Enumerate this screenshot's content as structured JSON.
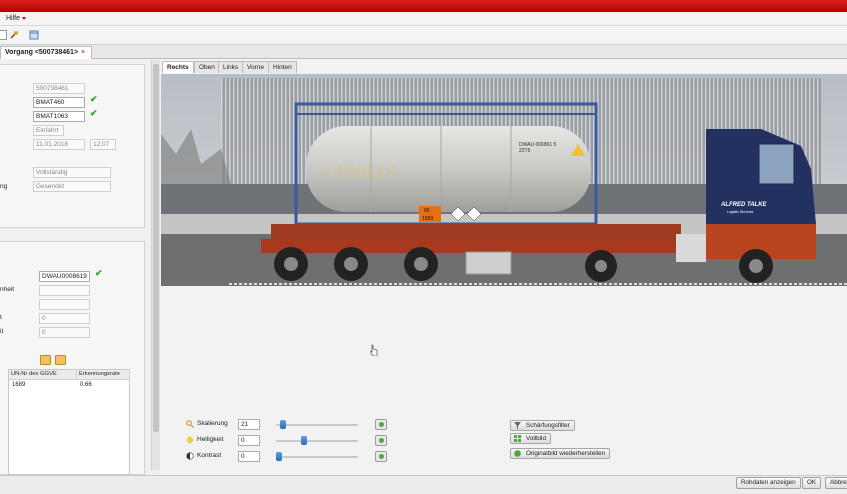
{
  "menu": {
    "help_label": "Hilfe"
  },
  "doc_tab": {
    "label": "Vorgang <500738461>",
    "close": "×"
  },
  "details": {
    "vorgang_nr": "500738461",
    "field2": "BMAT460",
    "field3": "BMAT1063",
    "richtung": "Einfahrt",
    "datum": "11.01.2018",
    "zeit": "12:07",
    "status1": "Vollständig",
    "status2_label": "ng",
    "status2": "Gesendet"
  },
  "detection": {
    "code": "DWAU0008619",
    "label_einheit": "nheit",
    "label_t": "t",
    "label_it": "it",
    "value1": "0",
    "value2": "0"
  },
  "table": {
    "headers": [
      "UN-Nr des GGVE",
      "Erkennungsrate"
    ],
    "rows": [
      {
        "un": "1689",
        "rate": "0.66"
      }
    ]
  },
  "view_tabs": [
    "Rechts",
    "Oben",
    "Links",
    "Vorne",
    "Hinten"
  ],
  "truck": {
    "container_code": "DWAU 006861 5",
    "container_iso": "22T6",
    "hazard_top": "66",
    "hazard_bottom": "1689",
    "brand": "ALFRED TALKE",
    "brand_sub": "Logistic Services",
    "tank_brand": "CYPRESS"
  },
  "adjust": {
    "scale_label": "Skalierung",
    "scale_value": "21",
    "scale_level": 0.05,
    "bright_label": "Helligkeit",
    "bright_value": "0",
    "bright_level": 0.33,
    "contrast_label": "Kontrast",
    "contrast_value": "0",
    "contrast_level": 0.0
  },
  "buttons": {
    "sharpen": "Schärfungsfilter",
    "fullscreen": "Vollbild",
    "restore": "Originalbild wiederherstellen"
  },
  "footer": {
    "raw": "Rohdaten anzeigen",
    "ok": "OK",
    "cancel": "Abbrechen"
  },
  "colors": {
    "accent_red": "#d41010",
    "ok_green": "#33a033",
    "truck_blue": "#22315f"
  }
}
